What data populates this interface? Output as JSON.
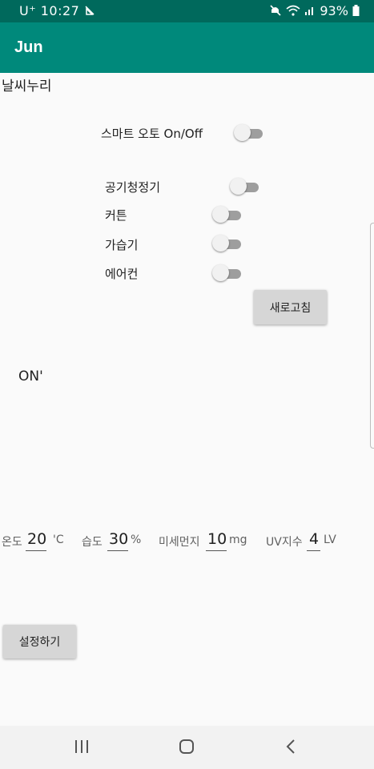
{
  "status_bar": {
    "carrier": "U⁺",
    "time": "10:27",
    "battery": "93%"
  },
  "app_bar": {
    "title": "Jun"
  },
  "header_label": "날씨누리",
  "smart_auto": {
    "label": "스마트 오토 On/Off",
    "on": false
  },
  "devices": [
    {
      "label": "공기청정기",
      "on": false
    },
    {
      "label": "커튼",
      "on": false
    },
    {
      "label": "가습기",
      "on": false
    },
    {
      "label": "에어컨",
      "on": false
    }
  ],
  "refresh_label": "새로고침",
  "status_text": "ON'",
  "readings": {
    "temp_label": "온도",
    "temp_value": "20",
    "temp_unit": "'C",
    "humidity_label": "습도",
    "humidity_value": "30",
    "humidity_unit": "%",
    "dust_label": "미세먼지",
    "dust_value": "10",
    "dust_unit": "mg",
    "uv_label": "UV지수",
    "uv_value": "4",
    "uv_unit": "LV"
  },
  "settings_label": "설정하기",
  "icons": {
    "recent": "recent-apps-icon",
    "home": "home-icon",
    "back": "back-icon"
  },
  "colors": {
    "status_bar": "#00695c",
    "app_bar": "#00897b",
    "accent_text": "#ad1457"
  }
}
